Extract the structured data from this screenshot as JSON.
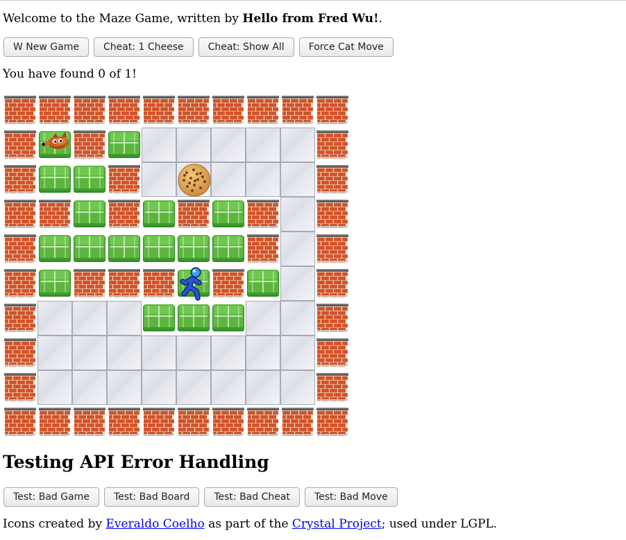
{
  "welcome": {
    "prefix": "Welcome to the Maze Game, written by ",
    "author": "Hello from Fred Wu!",
    "suffix": "."
  },
  "top_buttons": [
    "W New Game",
    "Cheat: 1 Cheese",
    "Cheat: Show All",
    "Force Cat Move"
  ],
  "status": "You have found 0 of 1!",
  "maze": {
    "rows": [
      "BBBBBBBBBB",
      "BCBGFFFFFB",
      "BGGBFKFFFB",
      "BBGBGBGBFB",
      "BGGGGGGBFB",
      "BGBBBMBGFB",
      "BFFFGGGFFB",
      "BFFFFFFFFB",
      "BFFFFFFFFB",
      "BBBBBBBBBB"
    ],
    "legend": {
      "B": "brick-wall",
      "G": "green-hedge",
      "F": "floor-tile",
      "C": "cat",
      "K": "cheese-cookie",
      "M": "mouse-runner"
    },
    "mouse_on": "green-hedge"
  },
  "section_heading": "Testing API Error Handling",
  "bottom_buttons": [
    "Test: Bad Game",
    "Test: Bad Board",
    "Test: Bad Cheat",
    "Test: Bad Move"
  ],
  "credits": {
    "prefix": "Icons created by ",
    "link1": "Everaldo Coelho",
    "middle": " as part of the ",
    "link2": "Crystal Project",
    "suffix": "; used under LGPL."
  },
  "colors": {
    "link": "#0000ee",
    "brick": "#d2542a",
    "hedge": "#5cb63e",
    "floor": "#e3e4ea"
  }
}
